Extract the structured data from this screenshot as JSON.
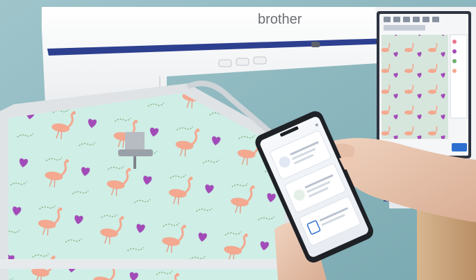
{
  "photo": {
    "brand_logo": "brother",
    "machine_screen": {
      "pattern": "flamingos-and-hearts"
    },
    "phone_app": {
      "cards": [
        "project-card",
        "design-card",
        "transfer-card"
      ]
    },
    "colors": {
      "background_teal": "#8db6bd",
      "fabric_mint": "#cfeee6",
      "flamingo_pink": "#f3a88f",
      "heart_purple": "#a24bb8",
      "machine_white": "#f4f5f6",
      "machine_blue_trim": "#2d3f8f",
      "table_wood": "#c9a27c"
    }
  }
}
